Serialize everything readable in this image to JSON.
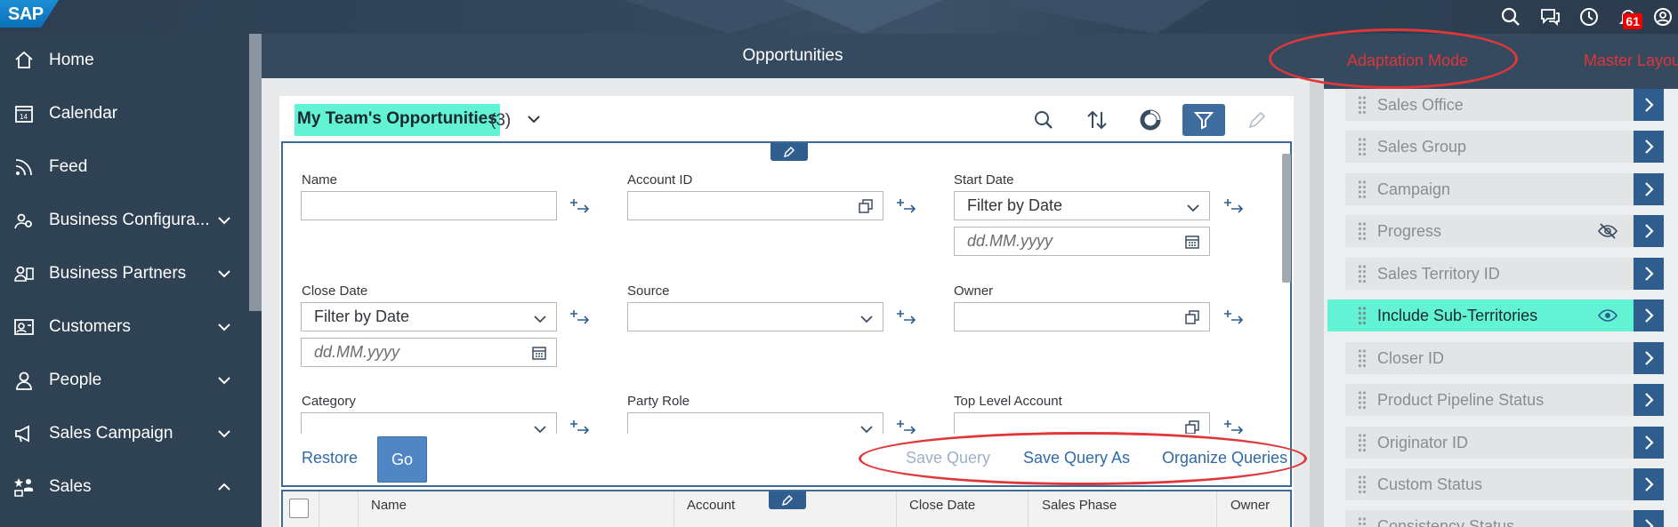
{
  "topbar": {
    "logo": "SAP",
    "notifications_count": "61"
  },
  "sidebar": {
    "items": [
      {
        "label": "Home",
        "icon": "home-icon",
        "expandable": false
      },
      {
        "label": "Calendar",
        "icon": "calendar-icon",
        "expandable": false
      },
      {
        "label": "Feed",
        "icon": "feed-icon",
        "expandable": false
      },
      {
        "label": "Business Configura...",
        "icon": "business-configuration-icon",
        "expandable": true
      },
      {
        "label": "Business Partners",
        "icon": "business-partners-icon",
        "expandable": true
      },
      {
        "label": "Customers",
        "icon": "customers-icon",
        "expandable": true
      },
      {
        "label": "People",
        "icon": "people-icon",
        "expandable": true
      },
      {
        "label": "Sales Campaign",
        "icon": "sales-campaign-icon",
        "expandable": true
      },
      {
        "label": "Sales",
        "icon": "sales-icon",
        "expandable": true,
        "expanded": true
      }
    ]
  },
  "main": {
    "title": "Opportunities",
    "query": {
      "title": "My Team's Opportunities",
      "count": "(3)"
    },
    "filters": {
      "name": {
        "label": "Name",
        "value": ""
      },
      "account_id": {
        "label": "Account ID",
        "value": ""
      },
      "start_date": {
        "label": "Start Date",
        "value": "Filter by Date",
        "date_placeholder": "dd.MM.yyyy"
      },
      "close_date": {
        "label": "Close Date",
        "value": "Filter by Date",
        "date_placeholder": "dd.MM.yyyy"
      },
      "source": {
        "label": "Source",
        "value": ""
      },
      "owner": {
        "label": "Owner",
        "value": ""
      },
      "category": {
        "label": "Category",
        "value": ""
      },
      "party_role": {
        "label": "Party Role",
        "value": ""
      },
      "top_level_account": {
        "label": "Top Level Account",
        "value": ""
      }
    },
    "footer": {
      "restore": "Restore",
      "go": "Go",
      "save_query": "Save Query",
      "save_query_as": "Save Query As",
      "organize_queries": "Organize Queries"
    },
    "table": {
      "columns": [
        "Name",
        "Account",
        "Close Date",
        "Sales Phase",
        "Owner"
      ]
    }
  },
  "right_panel": {
    "tabs": [
      "Adaptation Mode",
      "Master Layout"
    ],
    "fields": [
      {
        "label": "Sales Office",
        "eye": "none"
      },
      {
        "label": "Sales Group",
        "eye": "none"
      },
      {
        "label": "Campaign",
        "eye": "none"
      },
      {
        "label": "Progress",
        "eye": "hidden"
      },
      {
        "label": "Sales Territory ID",
        "eye": "none"
      },
      {
        "label": "Include Sub-Territories",
        "eye": "visible",
        "highlighted": true
      },
      {
        "label": "Closer ID",
        "eye": "none"
      },
      {
        "label": "Product Pipeline Status",
        "eye": "none"
      },
      {
        "label": "Originator ID",
        "eye": "none"
      },
      {
        "label": "Custom Status",
        "eye": "none"
      },
      {
        "label": "Consistency Status",
        "eye": "none"
      }
    ]
  },
  "colors": {
    "shell": "#354a5f",
    "highlight": "#62f3d5",
    "accent": "#2f5e8e",
    "annotation": "#e0373a"
  }
}
